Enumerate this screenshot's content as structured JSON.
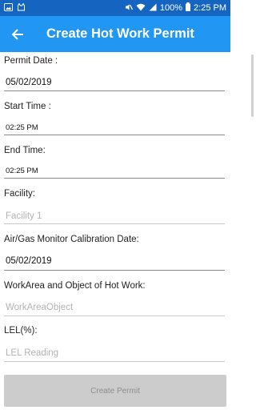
{
  "status_bar": {
    "battery": "100%",
    "time": "2:25 PM",
    "left_icons": [
      "image-icon",
      "cat-icon"
    ],
    "right_icons": [
      "mute-icon",
      "wifi-icon",
      "signal-icon",
      "battery-icon"
    ]
  },
  "toolbar": {
    "title": "Create Hot Work Permit",
    "color": "#2196f3",
    "status_color": "#1565c0"
  },
  "form": {
    "permit_date_label": "Permit Date :",
    "permit_date_value": "05/02/2019",
    "start_time_label": "Start Time :",
    "start_time_value": "02:25 PM",
    "end_time_label": "End Time:",
    "end_time_value": "02:25 PM",
    "facility_label": "Facility:",
    "facility_placeholder": "Facility 1",
    "calibration_date_label": "Air/Gas Monitor Calibration Date:",
    "calibration_date_value": "05/02/2019",
    "workarea_label": "WorkArea and Object of Hot Work:",
    "workarea_placeholder": "WorkAreaObject",
    "lel_label": "LEL(%):",
    "lel_placeholder": "LEL Reading"
  },
  "submit_label": "Create Permit"
}
